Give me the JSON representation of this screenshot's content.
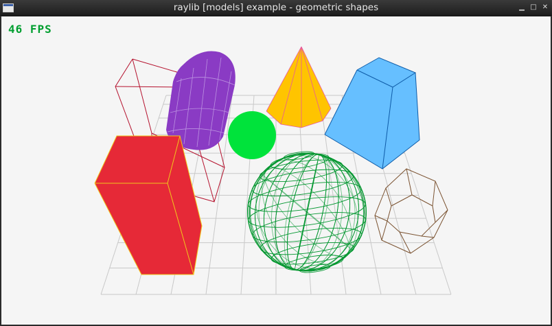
{
  "window": {
    "title": "raylib [models] example - geometric shapes",
    "controls": {
      "minimize": "▁",
      "maximize": "□",
      "close": "✕"
    }
  },
  "hud": {
    "fps_text": "46 FPS",
    "fps_color": "#009e2f"
  },
  "scene": {
    "background": "#f5f5f5",
    "grid_color": "#c8c8c8",
    "shapes": [
      {
        "kind": "cube-wires",
        "color": "#b5122e"
      },
      {
        "kind": "capsule",
        "color": "#8a3bc4",
        "wire_color": "#c9a8e8"
      },
      {
        "kind": "cone",
        "color": "#ffc400",
        "wire_color": "#e8589e"
      },
      {
        "kind": "truncated-pyramid",
        "color": "#66bfff",
        "wire_color": "#0f5ca8"
      },
      {
        "kind": "sphere",
        "color": "#00e33b"
      },
      {
        "kind": "cube",
        "color": "#e62937",
        "wire_color": "#f0c81c"
      },
      {
        "kind": "sphere-wires",
        "color": "#00962e"
      },
      {
        "kind": "cylinder-wires",
        "color": "#7a5230"
      }
    ]
  }
}
